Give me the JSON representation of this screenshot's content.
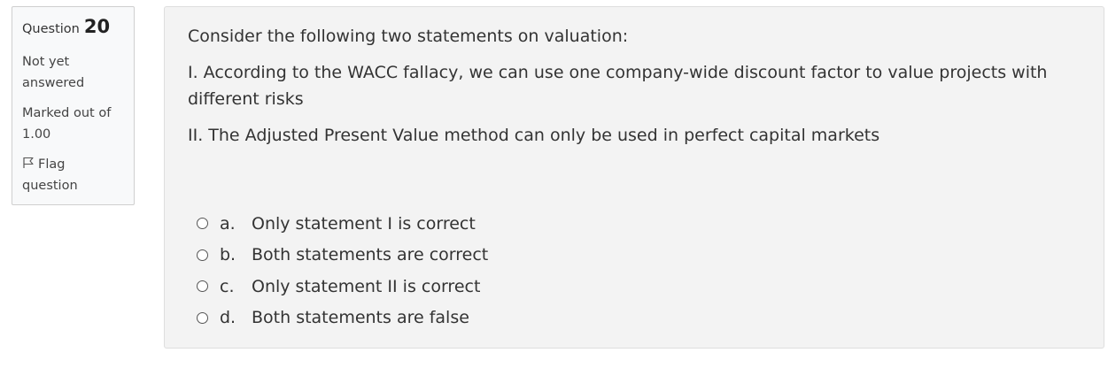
{
  "info": {
    "question_label": "Question",
    "question_number": "20",
    "state": "Not yet answered",
    "grade": "Marked out of 1.00",
    "flag_label": "Flag question"
  },
  "question": {
    "intro": "Consider the following two statements on valuation:",
    "statement_1": "I. According to the WACC fallacy, we can use one company-wide discount factor to value projects with different risks",
    "statement_2": "II. The Adjusted Present Value method can only be used in perfect capital markets"
  },
  "answers": [
    {
      "letter": "a.",
      "text": "Only statement I is correct"
    },
    {
      "letter": "b.",
      "text": "Both statements are correct"
    },
    {
      "letter": "c.",
      "text": "Only statement II is correct"
    },
    {
      "letter": "d.",
      "text": "Both statements are false"
    }
  ]
}
